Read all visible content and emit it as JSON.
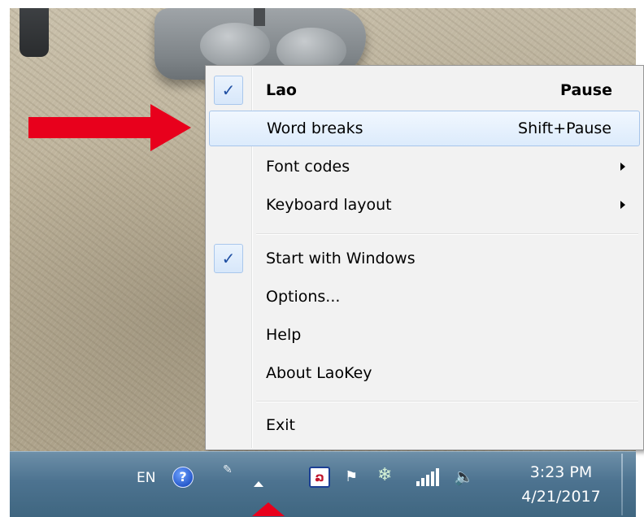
{
  "context_menu": {
    "items": [
      {
        "label": "Lao",
        "shortcut": "Pause",
        "checked": true,
        "bold": true
      },
      {
        "label": "Word breaks",
        "shortcut": "Shift+Pause",
        "highlighted": true
      },
      {
        "label": "Font codes",
        "submenu": true
      },
      {
        "label": "Keyboard layout",
        "submenu": true
      },
      {
        "label": "Start with Windows",
        "checked": true
      },
      {
        "label": "Options..."
      },
      {
        "label": "Help"
      },
      {
        "label": "About LaoKey"
      },
      {
        "label": "Exit"
      }
    ],
    "check_glyph": "✓"
  },
  "taskbar": {
    "language": "EN",
    "help_icon_glyph": "?",
    "laokey_icon_glyph": "ລ",
    "time": "3:23 PM",
    "date": "4/21/2017"
  },
  "colors": {
    "annotation_arrow": "#e8001c",
    "highlight_border": "#a7c5ea",
    "taskbar": "#4d7390"
  },
  "icons": [
    "help-icon",
    "pen-icon",
    "show-hidden-icons-icon",
    "laokey-icon",
    "action-center-flag-icon",
    "network-share-icon",
    "signal-icon",
    "volume-icon",
    "check-icon",
    "submenu-arrow-icon"
  ]
}
